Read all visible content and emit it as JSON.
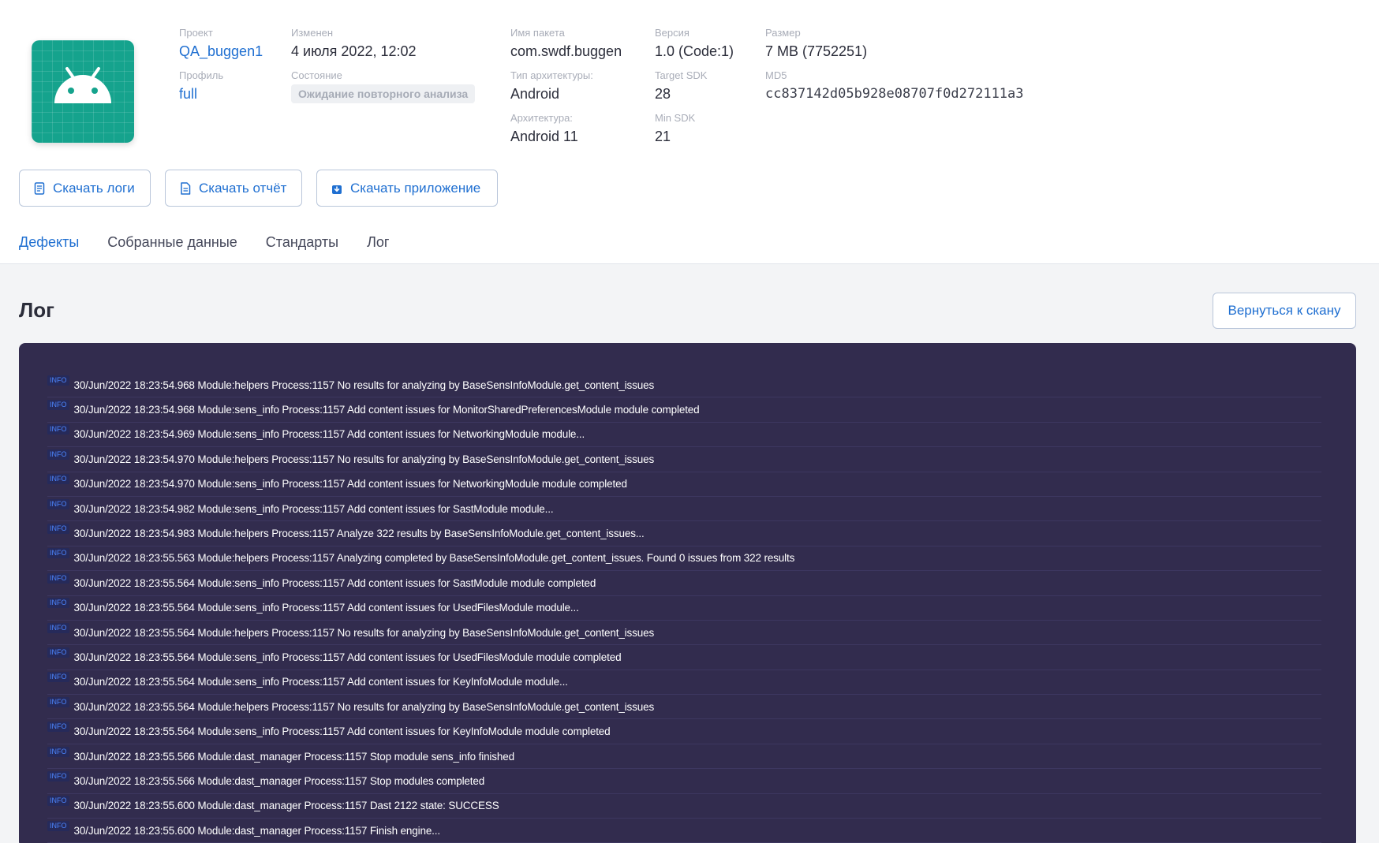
{
  "header": {
    "app_icon": "android-icon",
    "project": {
      "label": "Проект",
      "value": "QA_buggen1"
    },
    "profile": {
      "label": "Профиль",
      "value": "full"
    },
    "modified": {
      "label": "Изменен",
      "value": "4 июля 2022, 12:02"
    },
    "state": {
      "label": "Состояние",
      "value": "Ожидание повторного анализа"
    },
    "package": {
      "label": "Имя пакета",
      "value": "com.swdf.buggen"
    },
    "arch_type": {
      "label": "Тип архитектуры:",
      "value": "Android"
    },
    "arch": {
      "label": "Архитектура:",
      "value": "Android 11"
    },
    "version": {
      "label": "Версия",
      "value": "1.0 (Code:1)"
    },
    "target_sdk": {
      "label": "Target SDK",
      "value": "28"
    },
    "min_sdk": {
      "label": "Min SDK",
      "value": "21"
    },
    "size": {
      "label": "Размер",
      "value": "7 MB (7752251)"
    },
    "md5": {
      "label": "MD5",
      "value": "cc837142d05b928e08707f0d272111a3"
    }
  },
  "actions": {
    "download_logs": "Скачать логи",
    "download_report": "Скачать отчёт",
    "download_app": "Скачать приложение"
  },
  "tabs": [
    {
      "label": "Дефекты",
      "active": true
    },
    {
      "label": "Собранные данные",
      "active": false
    },
    {
      "label": "Стандарты",
      "active": false
    },
    {
      "label": "Лог",
      "active": false
    }
  ],
  "main": {
    "title": "Лог",
    "back_button": "Вернуться к скану"
  },
  "colors": {
    "accent": "#1f6fd1",
    "log_background": "#322c4e",
    "app_icon": "#15a38d"
  },
  "log": [
    {
      "level": "INFO",
      "message": "30/Jun/2022 18:23:54.968 Module:helpers Process:1157 No results for analyzing by BaseSensInfoModule.get_content_issues"
    },
    {
      "level": "INFO",
      "message": "30/Jun/2022 18:23:54.968 Module:sens_info Process:1157 Add content issues for MonitorSharedPreferencesModule module completed"
    },
    {
      "level": "INFO",
      "message": "30/Jun/2022 18:23:54.969 Module:sens_info Process:1157 Add content issues for NetworkingModule module..."
    },
    {
      "level": "INFO",
      "message": "30/Jun/2022 18:23:54.970 Module:helpers Process:1157 No results for analyzing by BaseSensInfoModule.get_content_issues"
    },
    {
      "level": "INFO",
      "message": "30/Jun/2022 18:23:54.970 Module:sens_info Process:1157 Add content issues for NetworkingModule module completed"
    },
    {
      "level": "INFO",
      "message": "30/Jun/2022 18:23:54.982 Module:sens_info Process:1157 Add content issues for SastModule module..."
    },
    {
      "level": "INFO",
      "message": "30/Jun/2022 18:23:54.983 Module:helpers Process:1157 Analyze 322 results by BaseSensInfoModule.get_content_issues..."
    },
    {
      "level": "INFO",
      "message": "30/Jun/2022 18:23:55.563 Module:helpers Process:1157 Analyzing completed by BaseSensInfoModule.get_content_issues. Found 0 issues from 322 results"
    },
    {
      "level": "INFO",
      "message": "30/Jun/2022 18:23:55.564 Module:sens_info Process:1157 Add content issues for SastModule module completed"
    },
    {
      "level": "INFO",
      "message": "30/Jun/2022 18:23:55.564 Module:sens_info Process:1157 Add content issues for UsedFilesModule module..."
    },
    {
      "level": "INFO",
      "message": "30/Jun/2022 18:23:55.564 Module:helpers Process:1157 No results for analyzing by BaseSensInfoModule.get_content_issues"
    },
    {
      "level": "INFO",
      "message": "30/Jun/2022 18:23:55.564 Module:sens_info Process:1157 Add content issues for UsedFilesModule module completed"
    },
    {
      "level": "INFO",
      "message": "30/Jun/2022 18:23:55.564 Module:sens_info Process:1157 Add content issues for KeyInfoModule module..."
    },
    {
      "level": "INFO",
      "message": "30/Jun/2022 18:23:55.564 Module:helpers Process:1157 No results for analyzing by BaseSensInfoModule.get_content_issues"
    },
    {
      "level": "INFO",
      "message": "30/Jun/2022 18:23:55.564 Module:sens_info Process:1157 Add content issues for KeyInfoModule module completed"
    },
    {
      "level": "INFO",
      "message": "30/Jun/2022 18:23:55.566 Module:dast_manager Process:1157 Stop module sens_info finished"
    },
    {
      "level": "INFO",
      "message": "30/Jun/2022 18:23:55.566 Module:dast_manager Process:1157 Stop modules completed"
    },
    {
      "level": "INFO",
      "message": "30/Jun/2022 18:23:55.600 Module:dast_manager Process:1157 Dast 2122 state: SUCCESS"
    },
    {
      "level": "INFO",
      "message": "30/Jun/2022 18:23:55.600 Module:dast_manager Process:1157 Finish engine..."
    }
  ]
}
